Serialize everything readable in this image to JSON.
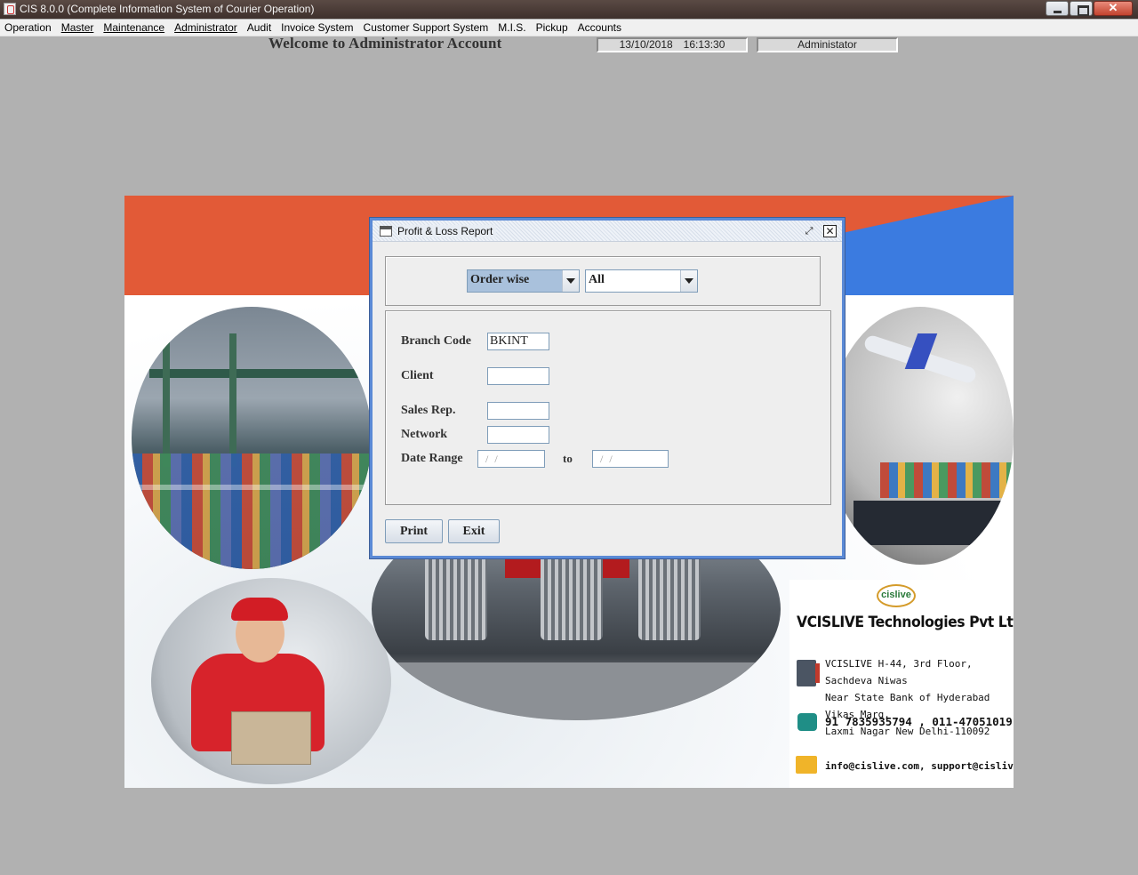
{
  "window": {
    "title": "CIS 8.0.0 (Complete Information System of Courier Operation)"
  },
  "menu": [
    {
      "label": "Operation"
    },
    {
      "label": "Master"
    },
    {
      "label": "Maintenance"
    },
    {
      "label": "Administrator"
    },
    {
      "label": "Audit"
    },
    {
      "label": "Invoice System"
    },
    {
      "label": "Customer Support System"
    },
    {
      "label": "M.I.S."
    },
    {
      "label": "Pickup"
    },
    {
      "label": "Accounts"
    }
  ],
  "header": {
    "welcome": "Welcome to Administrator Account",
    "date": "13/10/2018",
    "time": "16:13:30",
    "user": "Administator"
  },
  "dialog": {
    "title": "Profit & Loss Report",
    "report_type": "Order wise",
    "filter": "All",
    "fields": {
      "branch_code_label": "Branch Code",
      "branch_code_value": "BKINT",
      "client_label": "Client",
      "client_value": "",
      "sales_rep_label": "Sales Rep.",
      "sales_rep_value": "",
      "network_label": "Network",
      "network_value": "",
      "date_range_label": "Date Range",
      "date_from": "/ /",
      "to_label": "to",
      "date_to": "/ /"
    },
    "buttons": {
      "print": "Print",
      "exit": "Exit"
    }
  },
  "company": {
    "logo_text": "cislive",
    "name": "VCISLIVE Technologies Pvt Ltd",
    "address_line1": "VCISLIVE H-44, 3rd Floor, Sachdeva Niwas",
    "address_line2": "Near State Bank of Hyderabad Vikas Marg,",
    "address_line3": "Laxmi Nagar New Delhi-110092",
    "phone": "91 7835935794 , 011-47051019",
    "email": "info@cislive.com, support@cislive.com"
  },
  "colors": {
    "banner_red": "#e25a37",
    "banner_blue": "#3b7be0",
    "dialog_border": "#5b8ad6"
  }
}
